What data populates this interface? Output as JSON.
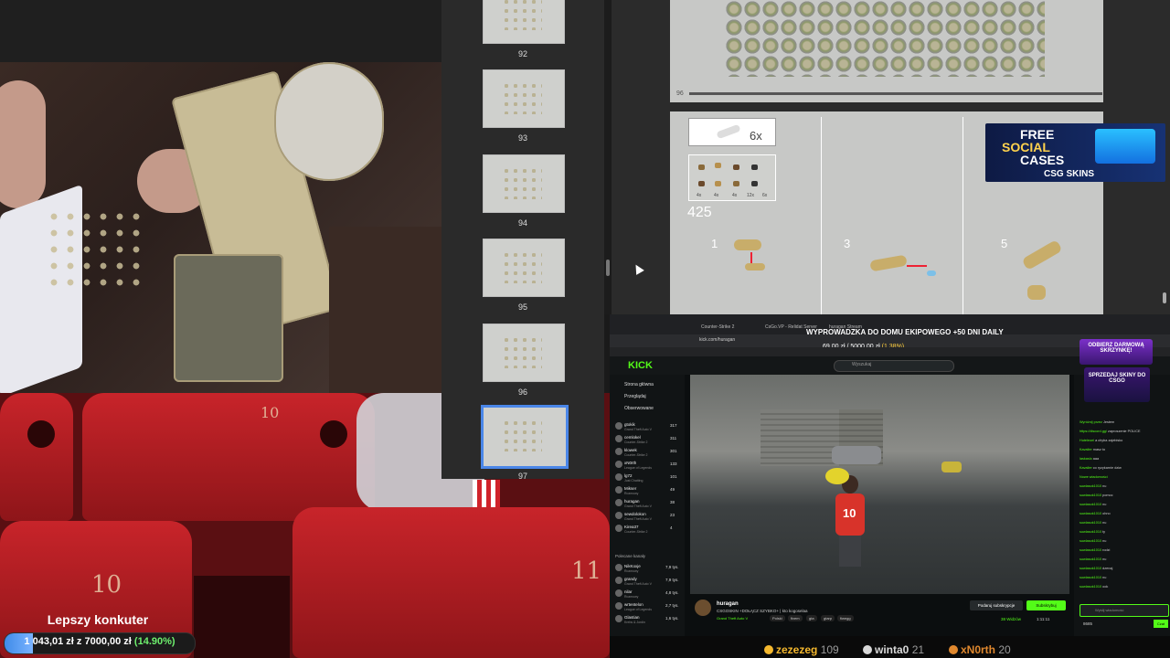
{
  "goal": {
    "title": "Lepszy konkuter",
    "current": "1 043,01 zł",
    "separator": "z",
    "target": "7000,00 zł",
    "percent": "(14.90%)",
    "progress_fraction": 0.149
  },
  "thumbnails": [
    {
      "label": "92"
    },
    {
      "label": "93"
    },
    {
      "label": "94"
    },
    {
      "label": "95"
    },
    {
      "label": "96"
    },
    {
      "label": "97",
      "selected": true
    }
  ],
  "manual": {
    "prev_page_number": "96",
    "part_count": "6x",
    "step_label": "425",
    "steps": [
      "1",
      "3",
      "5"
    ],
    "mini_part_labels": [
      "4x",
      "4x",
      "4x",
      "12x",
      "6x"
    ]
  },
  "ad": {
    "line1": "FREE",
    "line2": "SOCIAL",
    "line3": "CASES",
    "brand": "CSG SKINS"
  },
  "browser": {
    "banner": "WYPROWADZKA DO DOMU EKIPOWEGO +50 DNI DAILY",
    "url": "kick.com/huragan",
    "progress_amount": "69,00 zł / 5000,00 zł",
    "progress_pct": "(1.38%)",
    "tab_labels": [
      "Counter-Strike 2",
      "CsGo.VP - Relidat Server",
      "huragan Stream"
    ]
  },
  "kick": {
    "logo": "KICK",
    "search_placeholder": "Wyszukaj",
    "nav": [
      "Strona główna",
      "Przeglądaj",
      "Obserwowane"
    ],
    "channels_header": "Polecane kanały",
    "channels": [
      {
        "name": "gtokik",
        "game": "Grand Theft Auto V",
        "viewers": "317"
      },
      {
        "name": "cemlokel",
        "game": "Counter-Strike 2",
        "viewers": "311"
      },
      {
        "name": "klowek",
        "game": "Counter-Strike 2",
        "viewers": "301"
      },
      {
        "name": "xN0rth",
        "game": "League of Legends",
        "viewers": "133"
      },
      {
        "name": "lg72",
        "game": "Just Chatting",
        "viewers": "101"
      },
      {
        "name": "Mikser",
        "game": "Rozmowy",
        "viewers": "49"
      },
      {
        "name": "huragan",
        "game": "Grand Theft Auto V",
        "viewers": "38"
      },
      {
        "name": "sewdolokon",
        "game": "Grand Theft Auto V",
        "viewers": "23"
      },
      {
        "name": "Kirea37",
        "game": "Counter-Strike 2",
        "viewers": "4"
      }
    ],
    "recommended": [
      {
        "name": "NikKoxje",
        "game": "Rozmowy",
        "viewers": "7,9 tys."
      },
      {
        "name": "grandy",
        "game": "Grand Theft Auto V",
        "viewers": "7,9 tys."
      },
      {
        "name": "nilar",
        "game": "Rozmowy",
        "viewers": "4,8 tys."
      },
      {
        "name": "wrtentelon",
        "game": "League of Legends",
        "viewers": "2,7 tys."
      },
      {
        "name": "Glastian",
        "game": "Krebs & Jordin",
        "viewers": "1,6 tys."
      }
    ],
    "streamer": {
      "name": "huragan",
      "title": "CSGOSKIN +DOŁĄCZ SZYBKO+ | kto kogoselaa",
      "game": "Grand Theft Auto V",
      "tags": [
        "Polski",
        "fivem",
        "gta",
        "gtarp",
        "fiwegg"
      ],
      "subscribe_label": "Podaruj subskrypcje",
      "follow_label": "Subskrybuj",
      "viewers": "38 Widzów",
      "time": "1:11:11"
    },
    "chat": {
      "promo1": "ODBIERZ DARMOWĄ SKRZYNKĘ!",
      "promo2": "SPRZEDAJ SKINY DO CSGO",
      "lines": [
        {
          "user": "Wyróżnij przez",
          "text": "Jestem"
        },
        {
          "user": "https://discord.gg/",
          "text": "zaproszenie POLICE"
        },
        {
          "user": "Huteleoel",
          "text": "a chyba zajebisko"
        },
        {
          "user": "Kavalier",
          "text": "masz to"
        },
        {
          "user": "laskaslo",
          "text": "aaa"
        },
        {
          "user": "Kavalier",
          "text": "co ryzykarnie dziw"
        },
        {
          "user": "Nowe wiadomości",
          "text": ""
        },
        {
          "user": "suwlasok1010",
          "text": "nu"
        },
        {
          "user": "suwlasok1010",
          "text": "pomoc"
        },
        {
          "user": "suwlasok1010",
          "text": "nu"
        },
        {
          "user": "suwlasok1010",
          "text": "ohno"
        },
        {
          "user": "suwlasok1010",
          "text": "nu"
        },
        {
          "user": "suwlasok1010",
          "text": "ty"
        },
        {
          "user": "suwlasok1010",
          "text": "nu"
        },
        {
          "user": "suwlasok1010",
          "text": "rodzi"
        },
        {
          "user": "suwlasok1010",
          "text": "nu"
        },
        {
          "user": "suwlasok1010",
          "text": "dzenaj"
        },
        {
          "user": "suwlasok1010",
          "text": "nu"
        },
        {
          "user": "suwlasok1010",
          "text": "ook"
        }
      ],
      "input_placeholder": "Wyślij wiadomość",
      "send_label": "Czat",
      "points": "8685"
    }
  },
  "leaderboard": [
    {
      "name": "zezezeg",
      "score": "109",
      "color": "#f5b82e"
    },
    {
      "name": "winta0",
      "score": "21",
      "color": "#d8d8d8"
    },
    {
      "name": "xN0rth",
      "score": "20",
      "color": "#e0882e"
    }
  ]
}
